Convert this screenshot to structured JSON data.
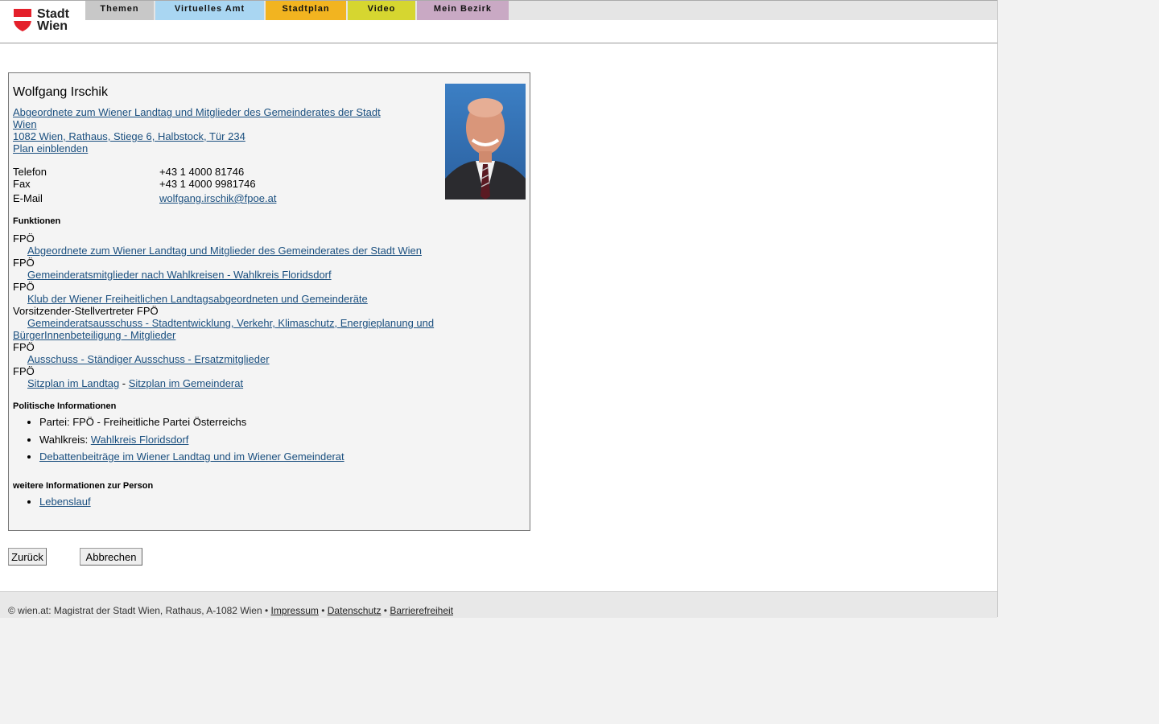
{
  "header": {
    "logo_line1": "Stadt",
    "logo_line2": "Wien",
    "tabs": [
      {
        "label": "Themen",
        "color": "#c8c8c8"
      },
      {
        "label": "Virtuelles Amt",
        "color": "#a9d6f2"
      },
      {
        "label": "Stadtplan",
        "color": "#f2b420"
      },
      {
        "label": "Video",
        "color": "#d6d630"
      },
      {
        "label": "Mein Bezirk",
        "color": "#c9a9c4"
      }
    ]
  },
  "person": {
    "name": "Wolfgang Irschik",
    "role_line1": "Abgeordnete zum Wiener Landtag und Mitglieder des Gemeinderates der Stadt",
    "role_line2": "Wien",
    "address": "1082 Wien, Rathaus, Stiege 6, Halbstock, Tür 234",
    "plan_link": "Plan einblenden",
    "contact": {
      "phone_label": "Telefon",
      "phone": "+43 1 4000 81746",
      "fax_label": "Fax",
      "fax": "+43 1 4000 9981746",
      "email_label": "E-Mail",
      "email": "wolfgang.irschik@fpoe.at"
    }
  },
  "funktionen": {
    "heading": "Funktionen",
    "items": [
      {
        "party": "FPÖ",
        "link": "Abgeordnete zum Wiener Landtag und Mitglieder des Gemeinderates der Stadt Wien"
      },
      {
        "party": "FPÖ",
        "link": "Gemeinderatsmitglieder nach Wahlkreisen - Wahlkreis Floridsdorf"
      },
      {
        "party": "FPÖ",
        "link": "Klub der Wiener Freiheitlichen Landtagsabgeordneten und Gemeinderäte"
      },
      {
        "party": "Vorsitzender-Stellvertreter FPÖ",
        "link_line1": "Gemeinderatsausschuss - Stadtentwicklung, Verkehr, Klimaschutz, Energieplanung und",
        "link_line2": "BürgerInnenbeteiligung - Mitglieder"
      },
      {
        "party": "FPÖ",
        "link": "Ausschuss - Ständiger Ausschuss - Ersatzmitglieder"
      },
      {
        "party": "FPÖ",
        "link_a": "Sitzplan im Landtag",
        "sep": " - ",
        "link_b": "Sitzplan im Gemeinderat"
      }
    ]
  },
  "politisch": {
    "heading": "Politische Informationen",
    "partei_label": "Partei: ",
    "partei": "FPÖ - Freiheitliche Partei Österreichs",
    "wahlkreis_label": "Wahlkreis: ",
    "wahlkreis": "Wahlkreis Floridsdorf",
    "debatten": "Debattenbeiträge im Wiener Landtag und im Wiener Gemeinderat"
  },
  "weitere": {
    "heading": "weitere Informationen zur Person",
    "lebenslauf": "Lebenslauf"
  },
  "buttons": {
    "back": "Zurück",
    "cancel": "Abbrechen"
  },
  "footer": {
    "copyright": "© wien.at: Magistrat der Stadt Wien, Rathaus, A-1082 Wien",
    "bullet": " • ",
    "impressum": "Impressum",
    "datenschutz": "Datenschutz",
    "barrierefreiheit": "Barrierefreiheit"
  }
}
